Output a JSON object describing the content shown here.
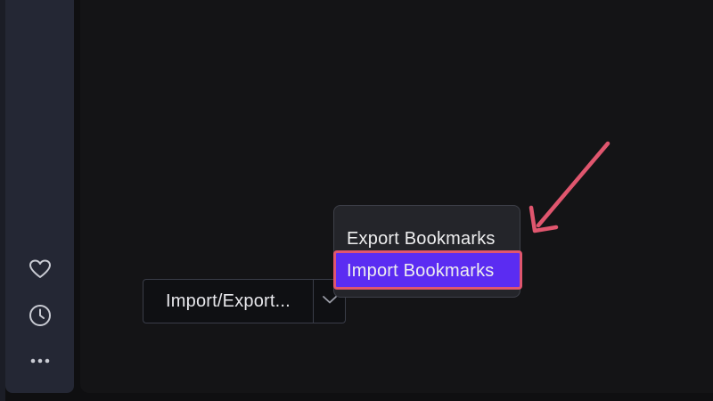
{
  "split_button": {
    "label": "Import/Export..."
  },
  "dropdown": {
    "items": [
      {
        "label": "Export Bookmarks"
      },
      {
        "label": "Import Bookmarks",
        "highlighted": true
      }
    ]
  },
  "sidebar": {
    "icons": [
      "heart-icon",
      "clock-icon",
      "more-icon"
    ]
  },
  "colors": {
    "highlight_bg": "#5b2cf2",
    "annotation": "#e0566e",
    "sidebar_bg": "#242734",
    "panel_bg": "#141416"
  }
}
